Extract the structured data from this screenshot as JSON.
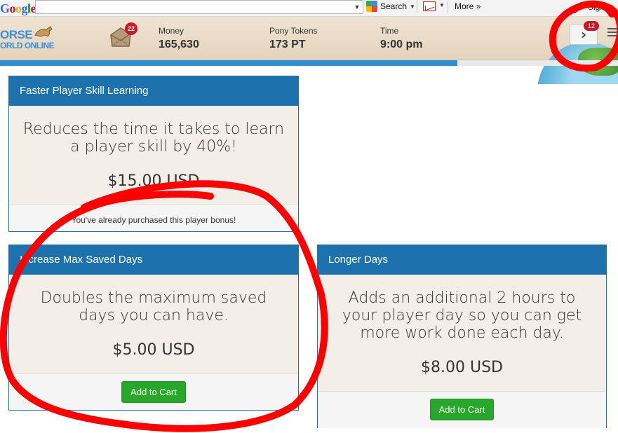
{
  "browser_toolbar": {
    "search_letters": [
      "G",
      "o",
      "o",
      "g",
      "l",
      "e"
    ],
    "search_value": "",
    "search_button": "Search",
    "more_label": "More",
    "signin_label": "Sign In"
  },
  "game_header": {
    "logo_top": "ORSE",
    "logo_bottom": "ORLD ONLINE",
    "inbox_count": "22",
    "money_label": "Money",
    "money_value": "165,630",
    "tokens_label": "Pony Tokens",
    "tokens_value": "173 PT",
    "time_label": "Time",
    "time_value": "9:00 pm",
    "notifications_count": "12",
    "progress_percent": 74
  },
  "cards": [
    {
      "title": "Faster Player Skill Learning",
      "description": "Reduces the time it takes to learn a player skill by 40%!",
      "price": "$15.00 USD",
      "footer_note": "You've already purchased this player bonus!"
    },
    {
      "title": "Increase Max Saved Days",
      "description": "Doubles the maximum saved days you can have.",
      "price": "$5.00 USD",
      "button": "Add to Cart"
    },
    {
      "title": "Longer Days",
      "description": "Adds an additional 2 hours to your player day so you can get more work done each day.",
      "price": "$8.00 USD",
      "button": "Add to Cart"
    }
  ],
  "colors": {
    "card_header": "#1d72ae",
    "card_body": "#f4eee8",
    "cart_button": "#27a82a",
    "annotation": "#ff0000"
  }
}
